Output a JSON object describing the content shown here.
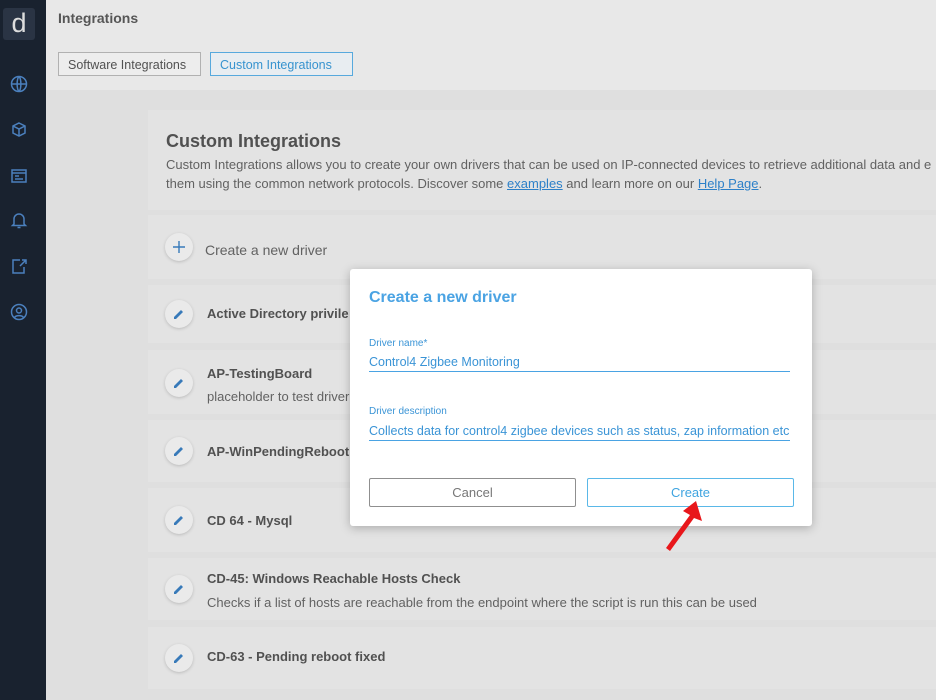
{
  "sidebar": {
    "logo": "d",
    "icons": [
      "globe-icon",
      "packages-icon",
      "dashboard-icon",
      "bell-icon",
      "export-icon",
      "user-circle-icon"
    ]
  },
  "header": {
    "title": "Integrations",
    "tabs": [
      {
        "label": "Software Integrations",
        "active": false
      },
      {
        "label": "Custom Integrations",
        "active": true
      }
    ]
  },
  "card": {
    "title": "Custom Integrations",
    "desc_line1": "Custom Integrations allows you to create your own drivers that can be used on IP-connected devices to retrieve additional data and e",
    "desc_line2_prefix": "them using the common network protocols. Discover some ",
    "examples_link": "examples",
    "desc_line2_middle": " and learn more on our ",
    "help_link": "Help Page",
    "desc_line2_suffix": "."
  },
  "drivers": {
    "create_label": "Create a new driver",
    "items": [
      {
        "name": "Active Directory privile",
        "desc": ""
      },
      {
        "name": "AP-TestingBoard",
        "desc": "placeholder to test driver"
      },
      {
        "name": "AP-WinPendingReboot",
        "desc": ""
      },
      {
        "name": "CD 64 - Mysql",
        "desc": ""
      },
      {
        "name": "CD-45: Windows Reachable Hosts Check",
        "desc": "Checks if a list of hosts are reachable from the endpoint where the script is run this can be used"
      },
      {
        "name": "CD-63 - Pending reboot fixed",
        "desc": ""
      }
    ]
  },
  "dialog": {
    "title": "Create a new driver",
    "name_label": "Driver name*",
    "name_value": "Control4 Zigbee Monitoring",
    "desc_label": "Driver description",
    "desc_value": "Collects data for control4 zigbee devices such as status, zap information etc",
    "cancel_label": "Cancel",
    "create_label": "Create"
  },
  "colors": {
    "accent": "#4aa3e3",
    "sidebar_bg": "#1b2431",
    "cursor": "#e8171b"
  }
}
